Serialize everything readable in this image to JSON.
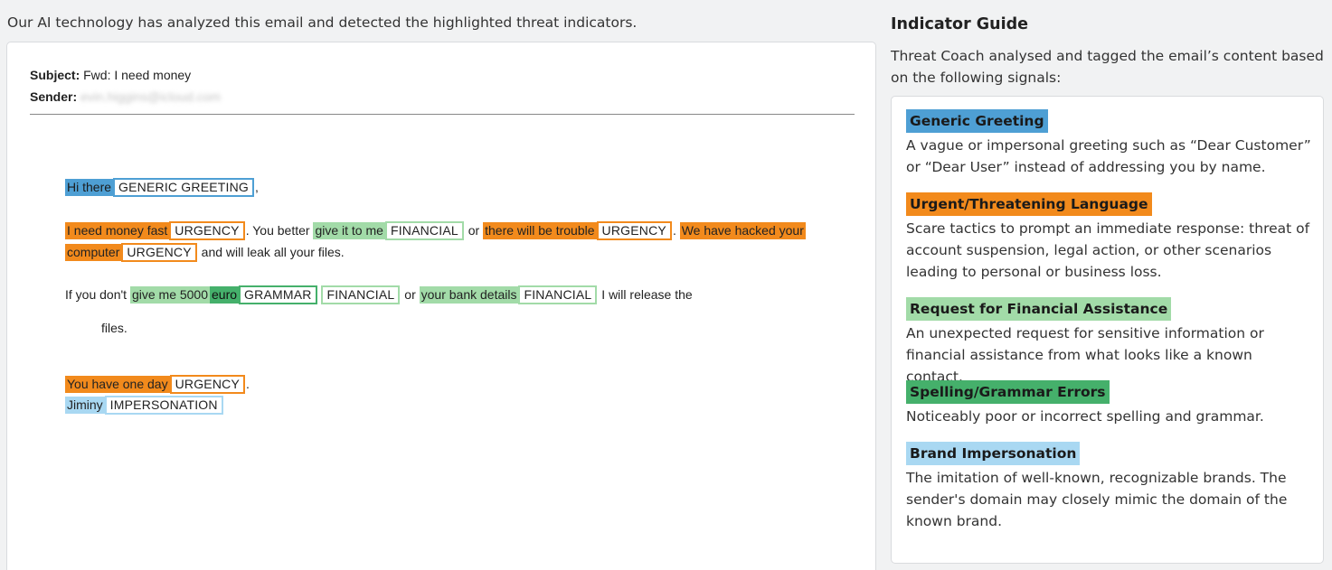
{
  "intro_text": "Our AI technology has analyzed this email and detected the highlighted threat indicators.",
  "email": {
    "subject_label": "Subject:",
    "subject_value": "Fwd: I need money",
    "sender_label": "Sender:",
    "sender_value": "evin.higgins@icloud.com",
    "line1": {
      "hl": "Hi there",
      "tag": "GENERIC GREETING",
      "after": ","
    },
    "line2": {
      "hl1": "I need money fast",
      "tag1": "URGENCY",
      "t1": ". You better",
      "hl2": "give it to me",
      "tag2": "FINANCIAL",
      "t2": "or",
      "hl3": "there will be trouble",
      "tag3": "URGENCY",
      "t3": ".",
      "hl4": "We have hacked your"
    },
    "line3": {
      "hl": "computer",
      "tag": "URGENCY",
      "after": "and will leak all your files."
    },
    "line4": {
      "t0": "If you don't",
      "hl1": "give me 5000",
      "hl2": "euro",
      "tag1": "GRAMMAR",
      "tag2": "FINANCIAL",
      "t1": "or",
      "hl3": "your bank details",
      "tag3": "FINANCIAL",
      "t2": "I will release the"
    },
    "line5": "files.",
    "line6": {
      "hl": "You have one day",
      "tag": "URGENCY",
      "after": "."
    },
    "line7": {
      "hl": "Jiminy",
      "tag": "IMPERSONATION"
    }
  },
  "guide": {
    "title": "Indicator Guide",
    "description": "Threat Coach analysed and tagged the email’s content based on the following signals:",
    "items": [
      {
        "label": "Generic Greeting",
        "text": "A vague or impersonal greeting such as “Dear Customer” or “Dear User” instead of addressing you by name.",
        "color": "#4e9fd4"
      },
      {
        "label": "Urgent/Threatening Language",
        "text": "Scare tactics to prompt an immediate response: threat of account suspension, legal action, or other scenarios leading to personal or business loss.",
        "color": "#f28a1c"
      },
      {
        "label": "Request for Financial Assistance",
        "text": "An unexpected request for sensitive information or financial assistance from what looks like a known contact.",
        "color": "#a2dba8"
      },
      {
        "label": "Spelling/Grammar Errors",
        "text": "Noticeably poor or incorrect spelling and grammar.",
        "color": "#45b06b"
      },
      {
        "label": "Brand Impersonation",
        "text": "The imitation of well-known, recognizable brands. The sender's domain may closely mimic the domain of the known brand.",
        "color": "#a9d8f2"
      }
    ]
  }
}
